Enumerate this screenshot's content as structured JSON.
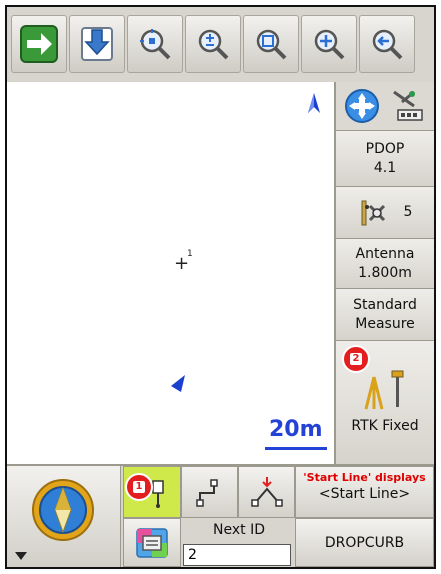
{
  "toolbar": {
    "buttons": [
      {
        "name": "arrow-right-icon"
      },
      {
        "name": "download-icon"
      },
      {
        "name": "zoom-center-icon"
      },
      {
        "name": "zoom-plus-minus-icon"
      },
      {
        "name": "zoom-window-icon"
      },
      {
        "name": "zoom-in-icon"
      },
      {
        "name": "back-arrow-icon"
      }
    ]
  },
  "map": {
    "point_id": "1",
    "scale": "20m",
    "colors": {
      "north": "#1a3fd1",
      "scale": "#2442d6"
    }
  },
  "status": {
    "pdop_label": "PDOP",
    "pdop_value": "4.1",
    "satellites": "5",
    "antenna_label": "Antenna",
    "antenna_value": "1.800m",
    "measure_line1": "Standard",
    "measure_line2": "Measure",
    "rtk": "RTK Fixed"
  },
  "bottom": {
    "start_line_note": "'Start Line' displays",
    "start_line_value": "<Start Line>",
    "next_id_label": "Next ID",
    "next_id_value": "2",
    "code": "DROPCURB"
  },
  "badges": {
    "one": "1",
    "two": "2"
  }
}
